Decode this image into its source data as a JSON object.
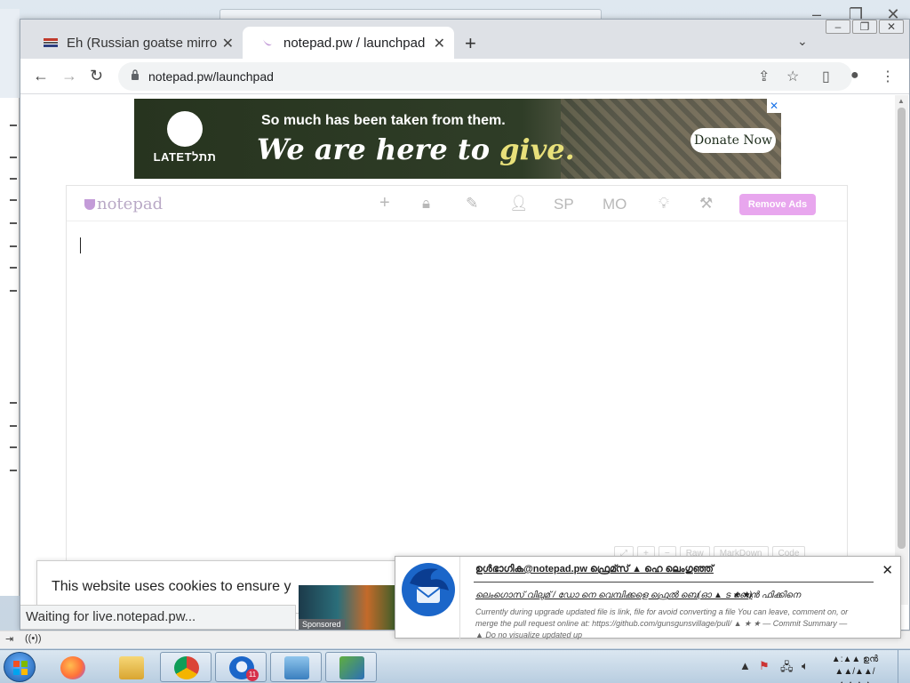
{
  "browser": {
    "tabs": [
      {
        "title": "Eh (Russian goatse mirro",
        "active": false
      },
      {
        "title": "notepad.pw / launchpad",
        "active": true
      }
    ],
    "new_tab_label": "+",
    "url": "notepad.pw/launchpad",
    "status_text": "Waiting for live.notepad.pw..."
  },
  "ad": {
    "brand": "LATETתתל",
    "line1": "So much has been taken from them.",
    "line2_prefix": "We are here to ",
    "line2_highlight": "give.",
    "donate_label": "Donate Now"
  },
  "notepad": {
    "logo_text": "notepad",
    "toolbar_text_sp": "SP",
    "toolbar_text_mo": "MO",
    "remove_ads_label": "Remove Ads",
    "footer_buttons": [
      "⤢",
      "+",
      "−",
      "Raw",
      "MarkDown",
      "Code"
    ]
  },
  "cookie": {
    "text": "This website uses cookies to ensure y"
  },
  "sponsored_label": "Sponsored",
  "notification": {
    "title": "ഉൾഭാഗിക@notepad.pw ഫ്രെമ്സ് ▲ ഹെ ലെംഗുഞ്ഞ്",
    "subject_line": "ലെംഗൊസ് വിലുമ് / ഡോ നെ വെമ്പിക്കളെ ഫ്രെൽ ബെ(ഓ ▲ ട ★ ★)",
    "from": "ബെൻ ഫിക്കിനെ",
    "body": "Currently during upgrade updated file is link, file for avoid converting a file You can leave, comment on, or merge the pull request online at: https://github.com/gunsgunsvillage/pull/ ▲ ★ ★ — Commit Summary — ▲ Do no visualize updated up"
  },
  "taskbar": {
    "thunderbird_badge": "11",
    "clock_time": "▲:▲▲ ഉൻ",
    "clock_date": "▲▲/▲▲/▲▲▲▲"
  },
  "colors": {
    "notepad_accent": "#e8a6ee",
    "ad_bg": "#2f3d27",
    "chrome_tabstrip": "#dee1e6"
  }
}
